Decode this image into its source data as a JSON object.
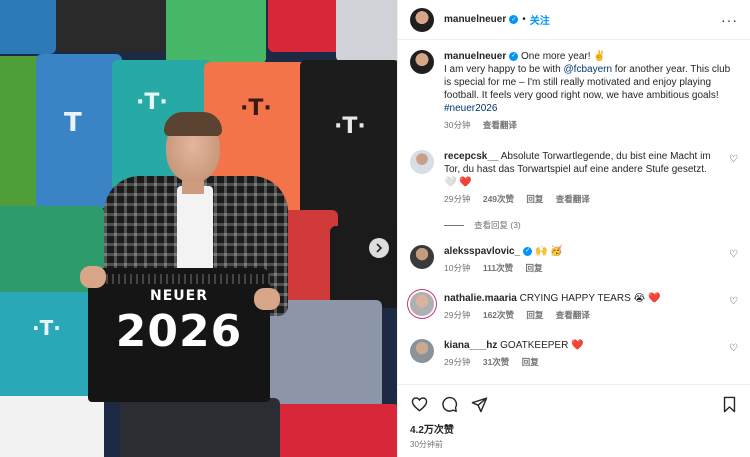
{
  "post": {
    "jersey_name": "NEUER",
    "jersey_number": "2026",
    "next_icon": "chevron-right-icon"
  },
  "author": {
    "username": "manuelneuer",
    "follow_label": "关注"
  },
  "caption": {
    "username": "manuelneuer",
    "text_first": "One more year! ✌️",
    "text_before_mention": "I am very happy to be with ",
    "mention": "@fcbayern",
    "text_after_mention": " for another year. This club is special for me – I'm still really motivated and enjoy playing football. It feels very good right now, we have ambitious goals!",
    "hashtag": "#neuer2026",
    "time": "30分钟",
    "translate": "查看翻译"
  },
  "comments": [
    {
      "username": "recepcsk__",
      "text": "Absolute Torwartlegende, du bist eine Macht im Tor, du hast das Torwartspiel auf eine andere Stufe gesetzt. 🤍 ❤️",
      "time": "29分钟",
      "likes": "249次赞",
      "reply": "回复",
      "translate": "查看翻译",
      "replies": "查看回复 (3)"
    },
    {
      "username": "aleksspavlovic_",
      "text": "🙌 🥳",
      "time": "10分钟",
      "likes": "111次赞",
      "reply": "回复"
    },
    {
      "username": "nathalie.maaria",
      "text": "CRYING HAPPY TEARS 😭 ❤️",
      "time": "29分钟",
      "likes": "162次赞",
      "reply": "回复",
      "translate": "查看翻译"
    },
    {
      "username": "kiana___hz",
      "text": "GOATKEEPER ❤️",
      "time": "29分钟",
      "likes": "31次赞",
      "reply": "回复"
    }
  ],
  "footer": {
    "likes": "4.2万次赞",
    "time": "30分钟前"
  },
  "colors": {
    "accent": "#0095f6",
    "link": "#00376b",
    "muted": "#737373",
    "heart": "#ed4956"
  }
}
